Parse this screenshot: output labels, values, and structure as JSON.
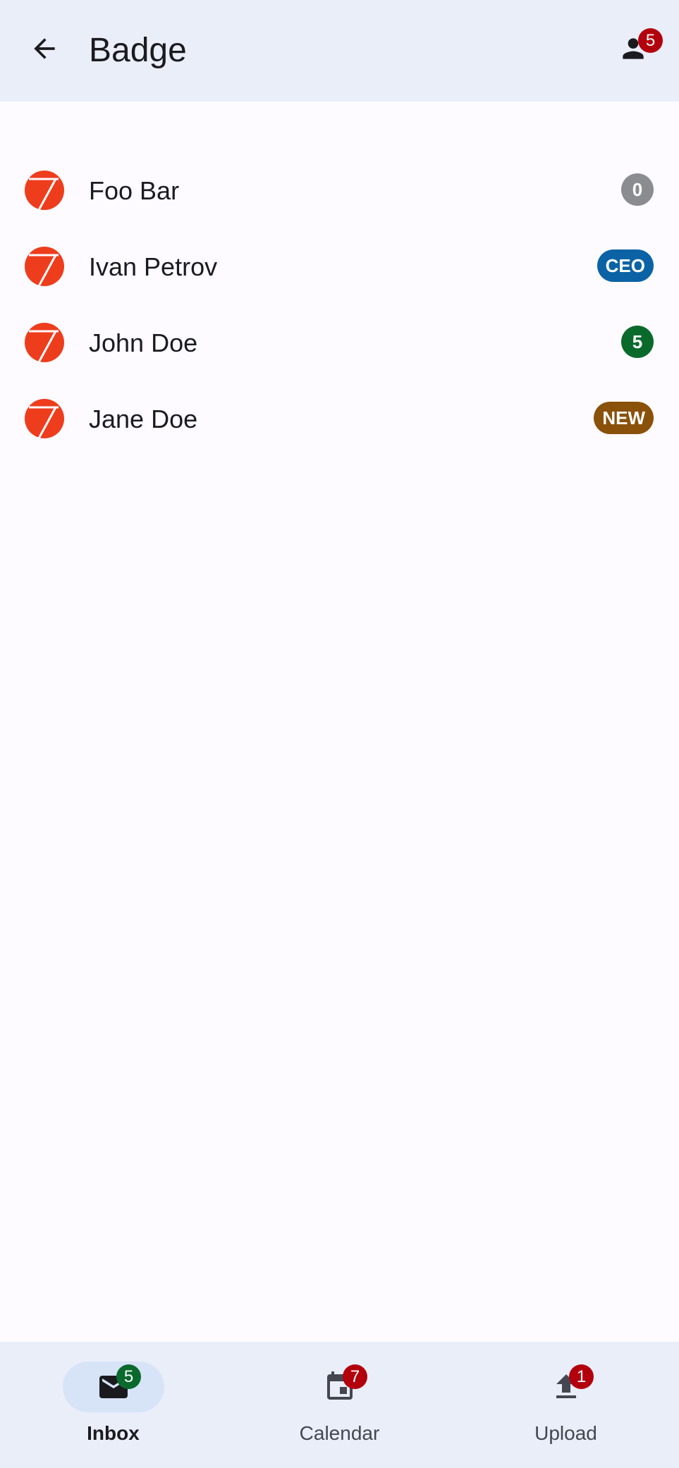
{
  "topbar": {
    "title": "Badge",
    "profile_badge": "5"
  },
  "list": {
    "items": [
      {
        "label": "Foo Bar",
        "badge": "0",
        "badge_color": "#8b8c90"
      },
      {
        "label": "Ivan Petrov",
        "badge": "CEO",
        "badge_color": "#0b63a5"
      },
      {
        "label": "John Doe",
        "badge": "5",
        "badge_color": "#0a6a2c"
      },
      {
        "label": "Jane Doe",
        "badge": "NEW",
        "badge_color": "#8a510b"
      }
    ]
  },
  "bottom_nav": {
    "items": [
      {
        "label": "Inbox",
        "badge": "5",
        "badge_color": "#0a6a2c",
        "icon": "mail-icon",
        "active": true
      },
      {
        "label": "Calendar",
        "badge": "7",
        "badge_color": "#b3000d",
        "icon": "calendar-icon",
        "active": false
      },
      {
        "label": "Upload",
        "badge": "1",
        "badge_color": "#b3000d",
        "icon": "upload-icon",
        "active": false
      }
    ]
  },
  "colors": {
    "bar_background": "#e9eef9",
    "page_background": "#fdfbff",
    "avatar": "#ee3d1c",
    "error_badge": "#b3000d",
    "active_indicator": "#d7e3f7"
  }
}
